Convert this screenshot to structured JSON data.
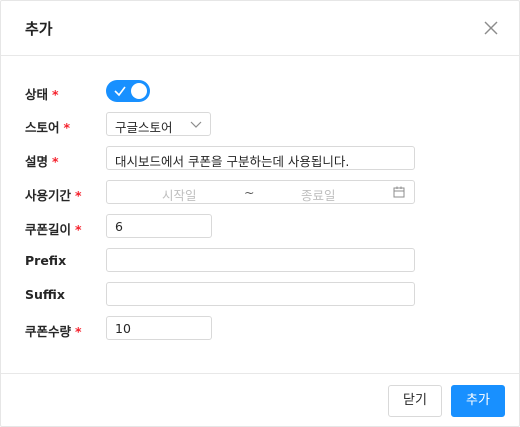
{
  "dialog": {
    "title": "추가",
    "close_icon": "close-icon"
  },
  "form": {
    "status": {
      "label": "상태",
      "required": "*",
      "checked": true
    },
    "store": {
      "label": "스토어",
      "required": "*",
      "value": "구글스토어"
    },
    "description": {
      "label": "설명",
      "required": "*",
      "placeholder": "대시보드에서 쿠폰을 구분하는데 사용됩니다.",
      "value": ""
    },
    "period": {
      "label": "사용기간",
      "required": "*",
      "start_placeholder": "시작일",
      "separator": "~",
      "end_placeholder": "종료일",
      "icon": "calendar-icon"
    },
    "coupon_length": {
      "label": "쿠폰길이",
      "required": "*",
      "value": "6"
    },
    "prefix": {
      "label": "Prefix",
      "value": ""
    },
    "suffix": {
      "label": "Suffix",
      "value": ""
    },
    "coupon_count": {
      "label": "쿠폰수량",
      "required": "*",
      "value": "10"
    }
  },
  "footer": {
    "close_label": "닫기",
    "add_label": "추가"
  },
  "colors": {
    "primary": "#1890ff",
    "required": "#f5222d"
  }
}
